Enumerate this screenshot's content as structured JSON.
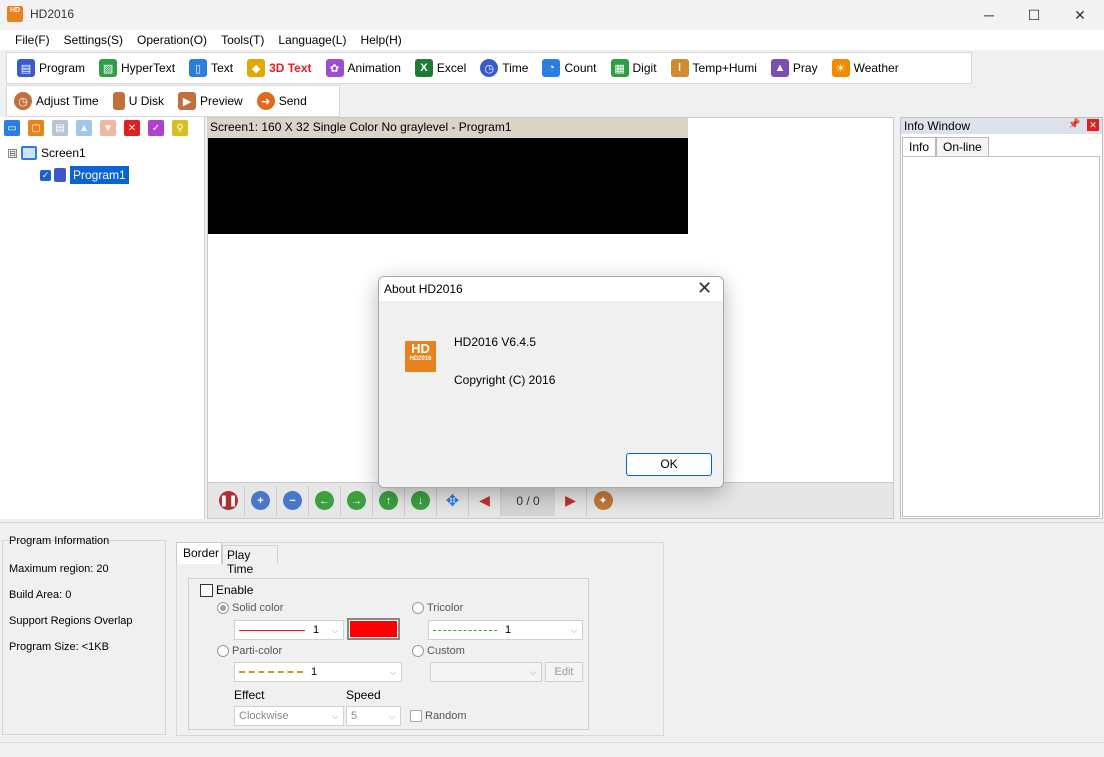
{
  "window": {
    "title": "HD2016",
    "logo_text": "HD",
    "minimize": "─",
    "maximize": "☐",
    "close": "✕"
  },
  "menu": [
    "File(F)",
    "Settings(S)",
    "Operation(O)",
    "Tools(T)",
    "Language(L)",
    "Help(H)"
  ],
  "toolbar1": [
    {
      "label": "Program",
      "icon": "program-icon",
      "color": "#3a5bd0"
    },
    {
      "label": "HyperText",
      "icon": "hypertext-icon",
      "color": "#2f9e44"
    },
    {
      "label": "Text",
      "icon": "text-icon",
      "color": "#2a7de1"
    },
    {
      "label": "3D Text",
      "icon": "3d-text-icon",
      "color": "#e0a800"
    },
    {
      "label": "Animation",
      "icon": "animation-icon",
      "color": "#9b4fd0"
    },
    {
      "label": "Excel",
      "icon": "excel-icon",
      "color": "#1e7b34"
    },
    {
      "label": "Time",
      "icon": "time-icon",
      "color": "#3a5bd0"
    },
    {
      "label": "Count",
      "icon": "count-icon",
      "color": "#2a7de1"
    },
    {
      "label": "Digit",
      "icon": "digit-icon",
      "color": "#2f9e44"
    },
    {
      "label": "Temp+Humi",
      "icon": "thermometer-icon",
      "color": "#d08a30"
    },
    {
      "label": "Pray",
      "icon": "pray-icon",
      "color": "#7a4fb0"
    },
    {
      "label": "Weather",
      "icon": "weather-icon",
      "color": "#f08a00"
    }
  ],
  "toolbar2": [
    {
      "label": "Adjust Time",
      "icon": "adjust-time-icon",
      "color": "#c0703a"
    },
    {
      "label": "U Disk",
      "icon": "usb-disk-icon",
      "color": "#c0703a"
    },
    {
      "label": "Preview",
      "icon": "preview-icon",
      "color": "#c0703a"
    },
    {
      "label": "Send",
      "icon": "send-icon",
      "color": "#e06a20"
    }
  ],
  "tree": {
    "screen": "Screen1",
    "program": "Program1",
    "expander": "⊟",
    "check_mark": "✓"
  },
  "preview": {
    "caption": "Screen1: 160 X 32  Single Color No graylevel - Program1",
    "page_counter": "0 / 0"
  },
  "info_window": {
    "title": "Info Window",
    "pin": "📌",
    "close": "✕",
    "tabs": [
      "Info",
      "On-line"
    ]
  },
  "program_info": {
    "heading": "Program Information",
    "max_region": "Maximum region: 20",
    "build_area": "Build Area: 0",
    "overlap": "Support Regions Overlap",
    "size": "Program Size: <1KB"
  },
  "border_tabs": {
    "border": "Border",
    "play_time": "Play Time"
  },
  "border_settings": {
    "enable": "Enable",
    "solid_color": "Solid color",
    "solid_width": "1",
    "tricolor": "Tricolor",
    "tricolor_width": "1",
    "parti_color": "Parti-color",
    "parti_width": "1",
    "custom": "Custom",
    "edit": "Edit",
    "effect_label": "Effect",
    "effect_value": "Clockwise",
    "speed_label": "Speed",
    "speed_value": "5",
    "random": "Random",
    "swatch_color": "#ff0000"
  },
  "about": {
    "title": "About HD2016",
    "close": "✕",
    "logo_text": "HD",
    "logo_sub": "HD2016",
    "version": "HD2016 V6.4.5",
    "copyright": "Copyright (C) 2016",
    "ok": "OK"
  }
}
